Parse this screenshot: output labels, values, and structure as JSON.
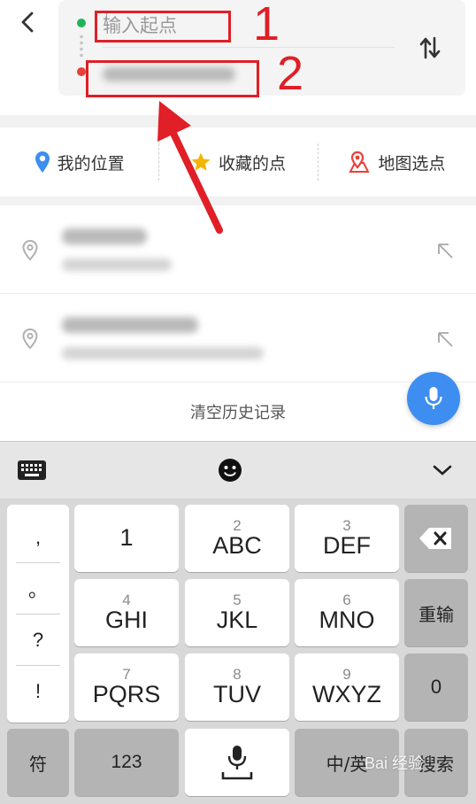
{
  "route": {
    "start_placeholder": "输入起点"
  },
  "annotations": {
    "label_1": "1",
    "label_2": "2",
    "color": "#e01f26"
  },
  "shortcuts": [
    {
      "label": "我的位置",
      "icon": "location-pin-icon"
    },
    {
      "label": "收藏的点",
      "icon": "star-icon"
    },
    {
      "label": "地图选点",
      "icon": "map-pin-icon"
    }
  ],
  "history": {
    "clear_label": "清空历史记录"
  },
  "keyboard": {
    "punctuation": [
      ",",
      "。",
      "?",
      "!"
    ],
    "keys": [
      {
        "num": "",
        "main": "1"
      },
      {
        "num": "2",
        "main": "ABC"
      },
      {
        "num": "3",
        "main": "DEF"
      },
      {
        "num": "4",
        "main": "GHI"
      },
      {
        "num": "5",
        "main": "JKL"
      },
      {
        "num": "6",
        "main": "MNO"
      },
      {
        "num": "7",
        "main": "PQRS"
      },
      {
        "num": "8",
        "main": "TUV"
      },
      {
        "num": "9",
        "main": "WXYZ"
      }
    ],
    "reinput_label": "重输",
    "zero_label": "0",
    "symbol_label": "符",
    "num_label": "123",
    "lang_label": "中/英",
    "search_label": "搜索"
  },
  "watermark": "Bai 经验",
  "colors": {
    "accent_blue": "#3d8ef0",
    "start_green": "#1fb35a",
    "end_red": "#e8413a",
    "star_yellow": "#f5b400"
  }
}
